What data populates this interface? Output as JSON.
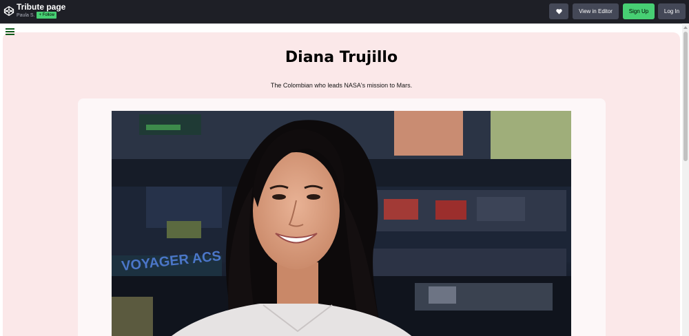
{
  "topbar": {
    "title": "Tribute page",
    "author": "Paula S.",
    "follow_label": "+ Follow",
    "heart_icon": "heart-icon",
    "view_in_editor_label": "View in Editor",
    "sign_up_label": "Sign Up",
    "log_in_label": "Log In",
    "colors": {
      "bar": "#1e1f26",
      "button": "#444857",
      "accent": "#47cf73"
    }
  },
  "page": {
    "menu_icon": "hamburger-icon",
    "heading": "Diana Trujillo",
    "subtitle": "The Colombian who leads NASA's mission to Mars.",
    "colors": {
      "background": "#fbe8e9",
      "card": "#fdf7f8",
      "menu": "#0e5b1b"
    }
  }
}
